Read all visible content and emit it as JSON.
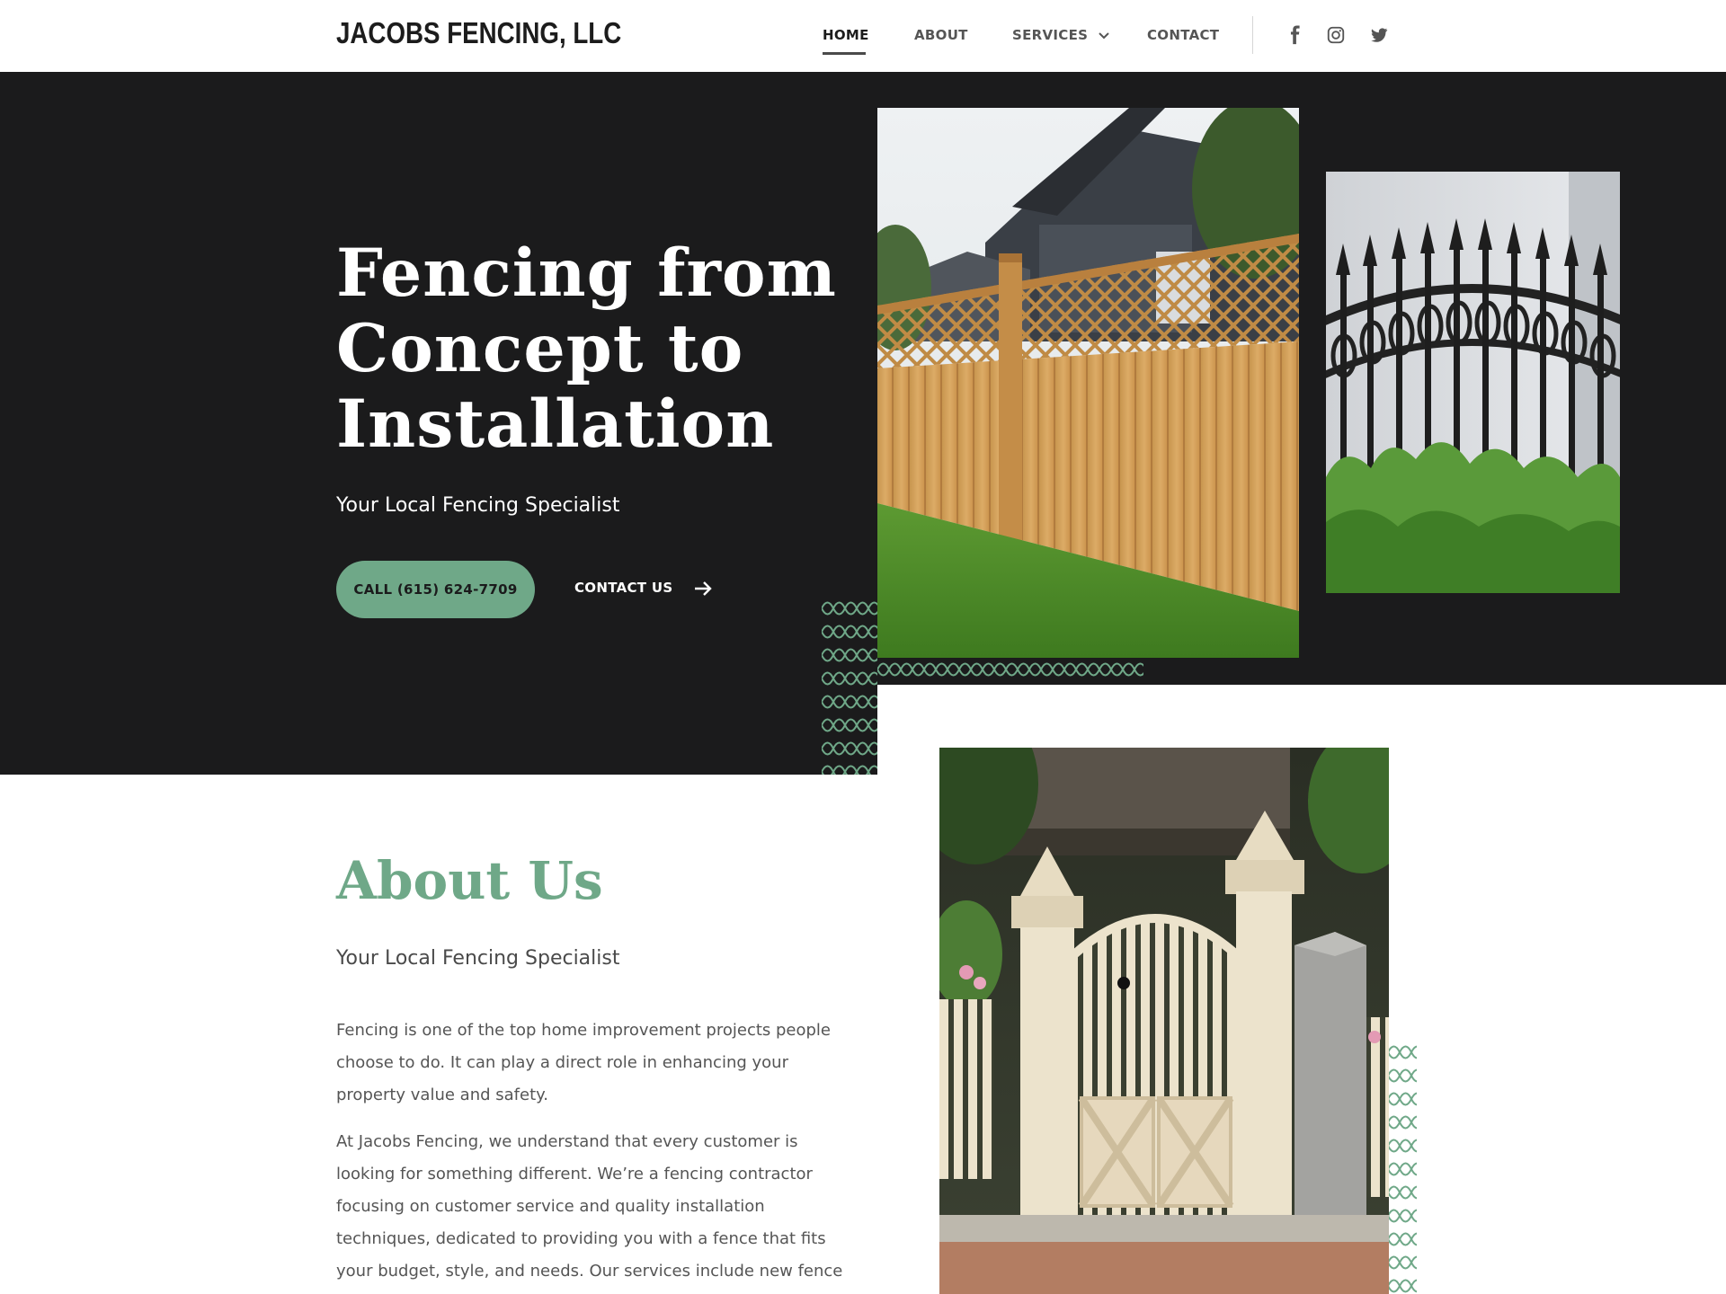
{
  "header": {
    "logo": "JACOBS FENCING, LLC",
    "nav": [
      {
        "label": "HOME"
      },
      {
        "label": "ABOUT"
      },
      {
        "label": "SERVICES"
      },
      {
        "label": "CONTACT"
      }
    ],
    "social_icons": [
      "facebook-icon",
      "instagram-icon",
      "twitter-icon"
    ]
  },
  "hero": {
    "title": "Fencing from Concept to Installation",
    "subtitle": "Your Local Fencing Specialist",
    "call_button": "CALL  (615) 624-7709",
    "contact_button": "CONTACT US"
  },
  "about": {
    "title": "About Us",
    "subtitle": "Your Local Fencing Specialist",
    "paragraphs": [
      "Fencing is one of the top home improvement projects people choose to do. It can play a direct role in enhancing your property value and safety.",
      "At Jacobs Fencing, we understand that every customer is looking for something different. We’re a fencing contractor focusing on customer service and quality installation techniques, dedicated to providing you with a fence that fits your budget, style, and needs. Our services include new fence"
    ]
  },
  "colors": {
    "accent": "#6fa888",
    "dark": "#1b1b1c",
    "text": "#4a4a4a"
  }
}
